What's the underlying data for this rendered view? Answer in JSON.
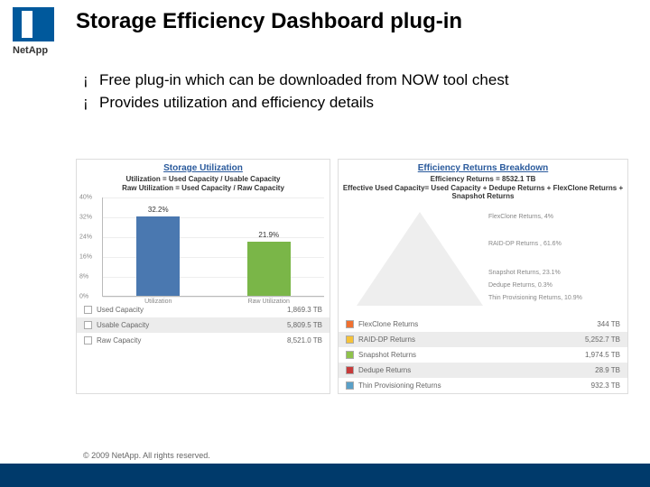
{
  "header": {
    "title": "Storage Efficiency Dashboard plug-in",
    "brand": "NetApp"
  },
  "bullets": [
    "Free plug-in which can be downloaded from NOW tool chest",
    "Provides utilization and efficiency details"
  ],
  "left_panel": {
    "title": "Storage Utilization",
    "subtitle1": "Utilization = Used Capacity / Usable Capacity",
    "subtitle2": "Raw Utilization = Used Capacity / Raw Capacity",
    "legend": [
      {
        "label": "Used Capacity",
        "value": "1,869.3 TB",
        "color": "#ffffff"
      },
      {
        "label": "Usable Capacity",
        "value": "5,809.5 TB",
        "color": "#ffffff"
      },
      {
        "label": "Raw Capacity",
        "value": "8,521.0 TB",
        "color": "#ffffff"
      }
    ]
  },
  "right_panel": {
    "title": "Efficiency Returns Breakdown",
    "subtitle1": "Efficiency Returns = 8532.1 TB",
    "subtitle2": "Effective Used Capacity= Used Capacity + Dedupe Returns + FlexClone Returns + Snapshot Returns",
    "pyramid_labels": [
      "FlexClone Returns, 4%",
      "RAID-DP Returns , 61.6%",
      "Snapshot Returns, 23.1%",
      "Dedupe Returns, 0.3%",
      "Thin Provisioning Returns, 10.9%"
    ],
    "legend": [
      {
        "label": "FlexClone Returns",
        "value": "344 TB",
        "color": "#f07030"
      },
      {
        "label": "RAID-DP Returns",
        "value": "5,252.7 TB",
        "color": "#f5c23a"
      },
      {
        "label": "Snapshot Returns",
        "value": "1,974.5 TB",
        "color": "#8fc24b"
      },
      {
        "label": "Dedupe Returns",
        "value": "28.9 TB",
        "color": "#c73a3a"
      },
      {
        "label": "Thin Provisioning Returns",
        "value": "932.3 TB",
        "color": "#5aa0c8"
      }
    ]
  },
  "chart_data": {
    "type": "bar",
    "title": "Storage Utilization",
    "categories": [
      "Utilization",
      "Raw Utilization"
    ],
    "values": [
      32.2,
      21.9
    ],
    "colors": [
      "#4a78b0",
      "#7ab648"
    ],
    "ylabel": "",
    "ylim": [
      0,
      40
    ],
    "yticks": [
      0,
      8,
      16,
      24,
      32,
      40
    ]
  },
  "footer": {
    "copyright": "© 2009 NetApp.  All rights reserved."
  }
}
